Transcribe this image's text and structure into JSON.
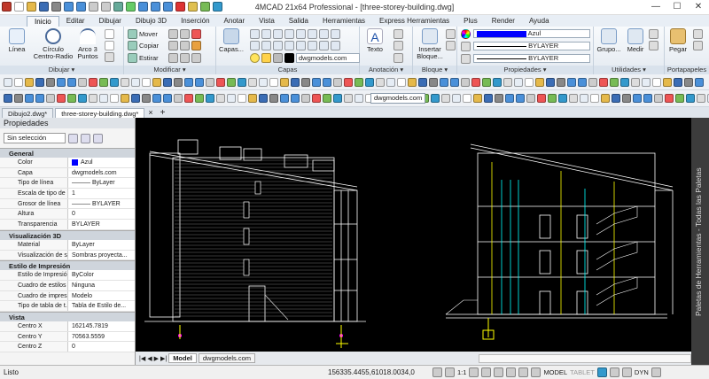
{
  "app": {
    "title": "4MCAD 21x64 Professional - [three-storey-building.dwg]"
  },
  "menu_tabs": [
    "Inicio",
    "Editar",
    "Dibujar",
    "Dibujo 3D",
    "Inserción",
    "Anotar",
    "Vista",
    "Salida",
    "Herramientas",
    "Express Herramientas",
    "Plus",
    "Render",
    "Ayuda"
  ],
  "ribbon": {
    "dibujar": {
      "title": "Dibujar ▾",
      "linea": "Línea",
      "circulo": "Círculo",
      "circulo_sub": "Centro-Radio",
      "arco": "Arco 3",
      "arco_sub": "Puntos"
    },
    "modificar": {
      "title": "Modificar ▾",
      "mover": "Mover",
      "copiar": "Copiar",
      "estirar": "Estirar"
    },
    "capas": {
      "title": "Capas",
      "capas_btn": "Capas...",
      "layer_value": "dwgmodels.com"
    },
    "anotacion": {
      "title": "Anotación ▾",
      "texto": "Texto"
    },
    "bloque": {
      "title": "Bloque ▾",
      "insertar": "Insertar",
      "insertar2": "Bloque..."
    },
    "propiedades": {
      "title": "Propiedades ▾",
      "color": "Azul",
      "linetype": "BYLAYER",
      "lineweight": "BYLAYER"
    },
    "utilidades": {
      "title": "Utilidades ▾",
      "grupo": "Grupo...",
      "medir": "Medir"
    },
    "portapapeles": {
      "title": "Portapapeles",
      "pegar": "Pegar"
    }
  },
  "toolbar2": {
    "layer_combo": "dwgmodels.com"
  },
  "doc_tabs": [
    "Dibujo2.dwg*",
    "three-storey-building.dwg*"
  ],
  "properties": {
    "title": "Propiedades",
    "selection": "Sin selección",
    "sections": [
      {
        "name": "General",
        "rows": [
          [
            "Color",
            "Azul"
          ],
          [
            "Capa",
            "dwgmodels.com"
          ],
          [
            "Tipo de línea",
            "——— ByLayer"
          ],
          [
            "Escala de tipo de ...",
            "1"
          ],
          [
            "Grosor de línea",
            "——— BYLAYER"
          ],
          [
            "Altura",
            "0"
          ],
          [
            "Transparencia",
            "BYLAYER"
          ]
        ]
      },
      {
        "name": "Visualización 3D",
        "rows": [
          [
            "Material",
            "ByLayer"
          ],
          [
            "Visualización de s...",
            "Sombras proyecta..."
          ]
        ]
      },
      {
        "name": "Estilo de Impresión",
        "rows": [
          [
            "Estilo de Impresión",
            "ByColor"
          ],
          [
            "Cuadro de estilos ...",
            "Ninguna"
          ],
          [
            "Cuadro de impresi...",
            "Modelo"
          ],
          [
            "Tipo de tabla de t...",
            "Tabla de Estilo de..."
          ]
        ]
      },
      {
        "name": "Vista",
        "rows": [
          [
            "Centro X",
            "162145.7819"
          ],
          [
            "Centro Y",
            "70563.5559"
          ],
          [
            "Centro Z",
            "0"
          ]
        ]
      }
    ]
  },
  "palette_label": "Paletas de Herramientas - Todas las Paletas",
  "layout_tabs": [
    "Model",
    "dwgmodels.com"
  ],
  "status": {
    "left": "Listo",
    "coords": "156335.4455,61018.0034,0",
    "scale": "1:1",
    "model": "MODEL",
    "tablet": "TABLET",
    "dyn": "DYN"
  },
  "colors": {
    "accent": "#0000ff",
    "ribbon_tab_active": "#f6f8fb",
    "canvas": "#000000",
    "drawing_white": "#ffffff",
    "drawing_cyan": "#00ffff",
    "drawing_yellow": "#ffff00",
    "drawing_magenta": "#ff00ff",
    "drawing_blue": "#3366ff"
  }
}
